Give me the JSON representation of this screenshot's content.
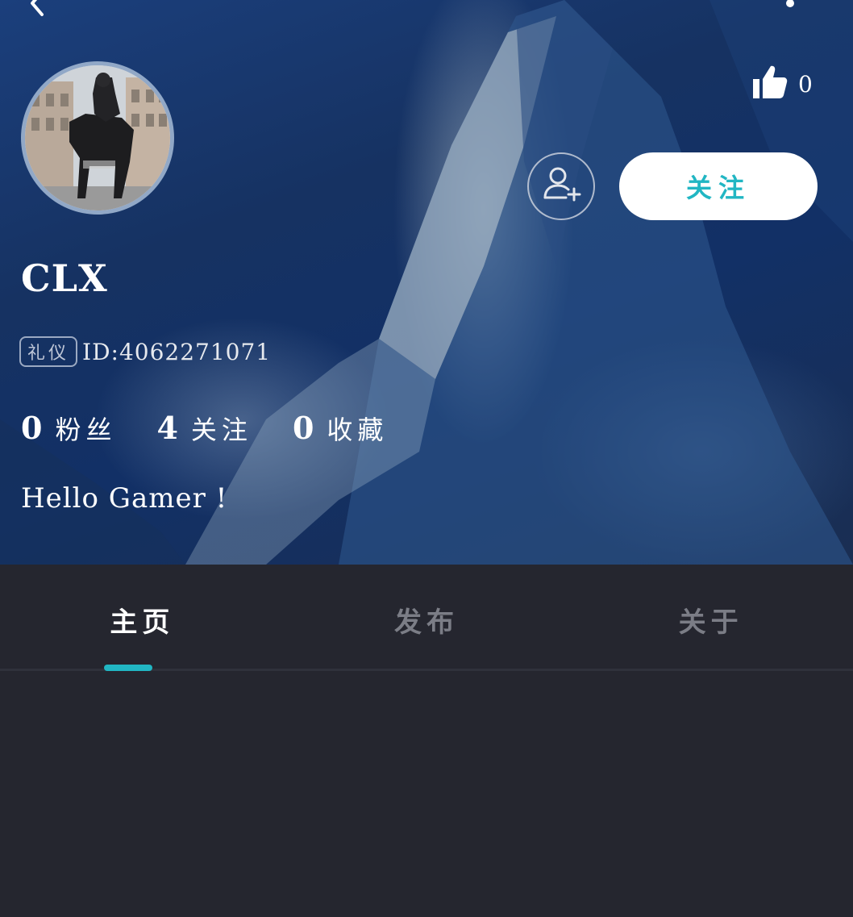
{
  "header": {
    "back_icon": "chevron-left-icon",
    "more_icon": "more-vertical-icon"
  },
  "profile": {
    "username": "CLX",
    "badge": "礼仪",
    "uid": "ID:4062271071",
    "bio": "Hello Gamer !",
    "like_count": "0"
  },
  "actions": {
    "add_friend_icon": "user-plus-icon",
    "follow_label": "关注"
  },
  "stats": [
    {
      "value": "0",
      "label": "粉丝"
    },
    {
      "value": "4",
      "label": "关注"
    },
    {
      "value": "0",
      "label": "收藏"
    }
  ],
  "tabs": [
    {
      "label": "主页",
      "active": true
    },
    {
      "label": "发布",
      "active": false
    },
    {
      "label": "关于",
      "active": false
    }
  ],
  "colors": {
    "accent": "#21b6c3",
    "background": "#25262f"
  }
}
